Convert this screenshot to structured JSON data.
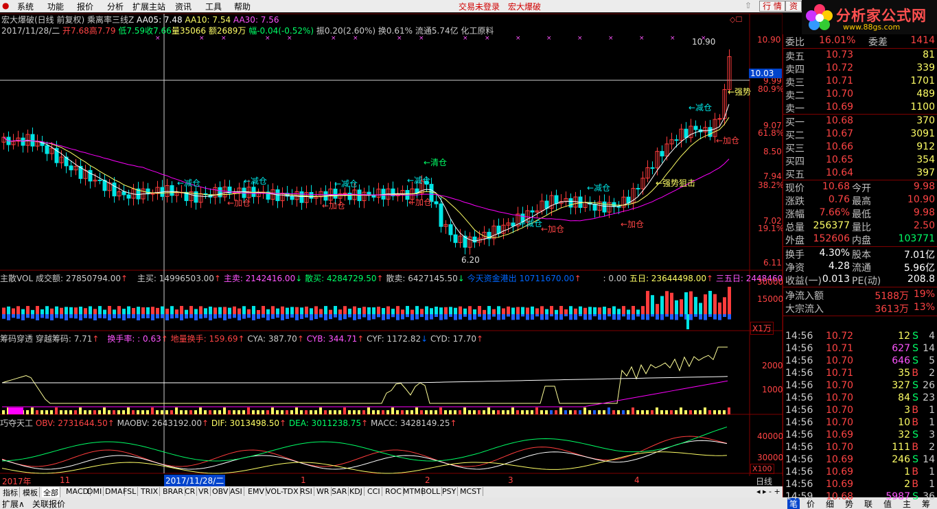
{
  "menu": {
    "items": [
      "系统",
      "功能",
      "报价",
      "分析",
      "扩展主站",
      "资讯",
      "工具",
      "帮助"
    ],
    "login": "交易未登录",
    "stock": "宏大爆破",
    "btn_quote": "行 情",
    "btn_info": "资"
  },
  "logo": {
    "text": "分析家公式网",
    "url": "www.88gs.com"
  },
  "header": {
    "line1": {
      "title": "宏大爆破(日线 前复权) 乘离率三线Z",
      "aa05": "AA05: 7.48",
      "aa10": "AA10: 7.54",
      "aa30": "AA30: 7.56"
    },
    "line2": {
      "date": "2017/11/28/二",
      "open": "开7.68",
      "high": "高7.79",
      "low": "低7.59",
      "close": "收7.66",
      "vol": "量35066",
      "amt": "额2689万",
      "chg": "幅-0.04(-0.52%)",
      "rest": "振0.20(2.60%) 换0.61% 流通5.74亿 化工原料"
    }
  },
  "main_chart": {
    "price_axis": [
      "10.90",
      "9.99",
      "9.07",
      "8.50",
      "7.94",
      "7.02",
      "6.11"
    ],
    "pct_axis": [
      "80.9%",
      "61.8%",
      "38.2%",
      "19.1%"
    ],
    "cursor_price": "10.03",
    "labels": {
      "top": "10.90",
      "bottom": "6.20",
      "qingcang": "←清仓",
      "jiancang": "←减仓",
      "jiacang": "←加仓",
      "qiangshi": "←强势狙击",
      "qiang": "←强势"
    },
    "colors": {
      "up": "#ff3c3c",
      "down": "#00e5e5",
      "ma_short": "#ffffff",
      "ma_mid": "#ffff66",
      "ma_long": "#ff00ff"
    }
  },
  "vol_panel": {
    "name": "主散VOL",
    "cjje": "成交额: 27850794.00",
    "zhumai": "主买: 14996503.00",
    "zhumai2": "主卖: 2142416.00",
    "sanmai": "散买: 4284729.50",
    "sanmai2": "散卖: 6427145.50",
    "jintian": "今天资金港出 10711670.00",
    "p": ": 0.00",
    "wuri": "五日: 23644498.00",
    "sanwuri": "三五日: 2448460",
    "axis": [
      "30000",
      "15000"
    ],
    "unit": "X1万"
  },
  "chip_panel": {
    "name": "筹码穿透",
    "cy": "穿越筹码: 7.71",
    "hs": "换手率: : 0.63",
    "dl": "地量换手: 159.69",
    "cya": "CYA: 387.70",
    "cyb": "CYB: 344.71",
    "cyf": "CYF: 1172.82",
    "cyd": "CYD: 17.70",
    "axis": [
      "2000",
      "1000"
    ]
  },
  "obv_panel": {
    "name": "巧夺天工",
    "obv": "OBV: 2731644.50",
    "maobv": "MAOBV: 2643192.00",
    "dif": "DIF: 3013498.50",
    "dea": "DEA: 3011238.75",
    "macc": "MACC: 3428149.25",
    "axis": [
      "40000",
      "30000"
    ],
    "unit": "X100"
  },
  "time_axis": {
    "y2017": "2017年",
    "m11": "11",
    "cursor_date": "2017/11/28/二",
    "m1": "1",
    "m2": "2",
    "m3": "3",
    "m4": "4",
    "period": "日线"
  },
  "indicator_tabs": [
    "指标",
    "模板",
    "全部",
    "MACD",
    "DMI",
    "DMA",
    "FSL",
    "TRIX",
    "BRAR",
    "CR",
    "VR",
    "OBV",
    "ASI",
    "EMV",
    "VOL-TDX",
    "RSI",
    "WR",
    "SAR",
    "KDJ",
    "CCI",
    "ROC",
    "MTM",
    "BOLL",
    "PSY",
    "MCST"
  ],
  "bottom_tabs": [
    "扩展∧",
    "关联报价"
  ],
  "right_tabs": [
    "笔",
    "价",
    "细",
    "势",
    "联",
    "值",
    "主",
    "筹"
  ],
  "order_book": {
    "ratio": {
      "label": "委比",
      "value": "16.01%",
      "label2": "委差",
      "value2": "1414"
    },
    "sells": [
      {
        "label": "卖五",
        "price": "10.73",
        "vol": "81"
      },
      {
        "label": "卖四",
        "price": "10.72",
        "vol": "339"
      },
      {
        "label": "卖三",
        "price": "10.71",
        "vol": "1701"
      },
      {
        "label": "卖二",
        "price": "10.70",
        "vol": "489"
      },
      {
        "label": "卖一",
        "price": "10.69",
        "vol": "1100"
      }
    ],
    "buys": [
      {
        "label": "买一",
        "price": "10.68",
        "vol": "370"
      },
      {
        "label": "买二",
        "price": "10.67",
        "vol": "3091"
      },
      {
        "label": "买三",
        "price": "10.66",
        "vol": "912"
      },
      {
        "label": "买四",
        "price": "10.65",
        "vol": "354"
      },
      {
        "label": "买五",
        "price": "10.64",
        "vol": "397"
      }
    ]
  },
  "quote": [
    {
      "l1": "现价",
      "v1": "10.68",
      "l2": "今开",
      "v2": "9.98"
    },
    {
      "l1": "涨跌",
      "v1": "0.76",
      "l2": "最高",
      "v2": "10.90"
    },
    {
      "l1": "涨幅",
      "v1": "7.66%",
      "l2": "最低",
      "v2": "9.98"
    },
    {
      "l1": "总量",
      "v1": "256377",
      "l2": "量比",
      "v2": "2.50"
    },
    {
      "l1": "外盘",
      "v1": "152606",
      "l2": "内盘",
      "v2": "103771"
    }
  ],
  "fund": [
    {
      "l1": "换手",
      "v1": "4.30%",
      "l2": "股本",
      "v2": "7.01亿"
    },
    {
      "l1": "净资",
      "v1": "4.28",
      "l2": "流通",
      "v2": "5.96亿"
    },
    {
      "l1": "收益(一)",
      "v1": "0.013",
      "l2": "PE(动)",
      "v2": "208.8"
    }
  ],
  "flow": [
    {
      "label": "净流入额",
      "value": "5188万",
      "pct": "19%"
    },
    {
      "label": "大宗流入",
      "value": "3613万",
      "pct": "13%"
    }
  ],
  "ticks": [
    {
      "t": "14:56",
      "p": "10.72",
      "v": "12",
      "s": "S",
      "n": "4"
    },
    {
      "t": "14:56",
      "p": "10.71",
      "v": "627",
      "s": "S",
      "n": "14"
    },
    {
      "t": "14:56",
      "p": "10.70",
      "v": "646",
      "s": "S",
      "n": "5"
    },
    {
      "t": "14:56",
      "p": "10.71",
      "v": "35",
      "s": "B",
      "n": "2"
    },
    {
      "t": "14:56",
      "p": "10.70",
      "v": "327",
      "s": "S",
      "n": "26"
    },
    {
      "t": "14:56",
      "p": "10.70",
      "v": "84",
      "s": "S",
      "n": "23"
    },
    {
      "t": "14:56",
      "p": "10.70",
      "v": "3",
      "s": "B",
      "n": "1"
    },
    {
      "t": "14:56",
      "p": "10.70",
      "v": "10",
      "s": "B",
      "n": "1"
    },
    {
      "t": "14:56",
      "p": "10.69",
      "v": "32",
      "s": "S",
      "n": "3"
    },
    {
      "t": "14:56",
      "p": "10.70",
      "v": "111",
      "s": "B",
      "n": "2"
    },
    {
      "t": "14:56",
      "p": "10.69",
      "v": "246",
      "s": "S",
      "n": "14"
    },
    {
      "t": "14:56",
      "p": "10.69",
      "v": "1",
      "s": "B",
      "n": "1"
    },
    {
      "t": "14:56",
      "p": "10.69",
      "v": "2",
      "s": "B",
      "n": "1"
    },
    {
      "t": "14:59",
      "p": "10.68",
      "v": "5987",
      "s": "S",
      "n": "36"
    }
  ]
}
